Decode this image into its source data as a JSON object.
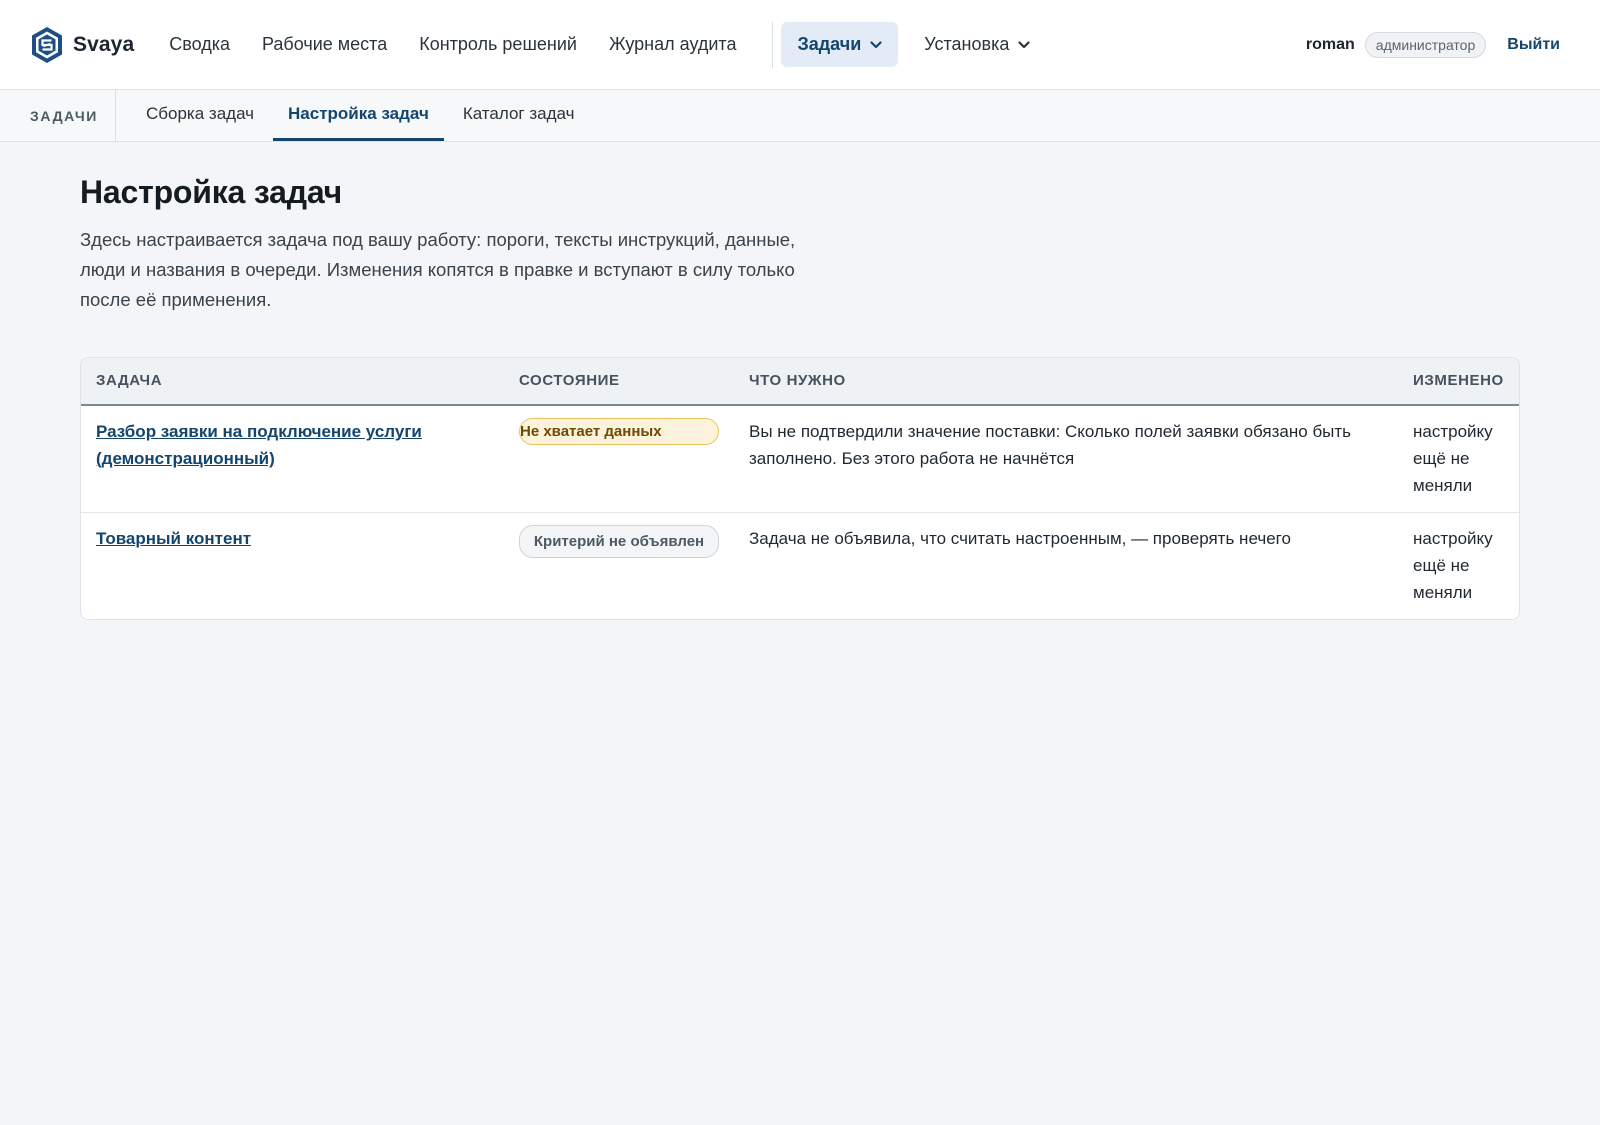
{
  "app": {
    "name": "Svaya"
  },
  "nav": {
    "items": [
      "Сводка",
      "Рабочие места",
      "Контроль решений",
      "Журнал аудита"
    ],
    "tasks": "Задачи",
    "install": "Установка"
  },
  "user": {
    "name": "roman",
    "role": "администратор",
    "logout": "Выйти"
  },
  "subnav": {
    "section": "ЗАДАЧИ",
    "tabs": [
      "Сборка задач",
      "Настройка задач",
      "Каталог задач"
    ],
    "active_tab": "Настройка задач"
  },
  "page": {
    "title": "Настройка задач",
    "description": "Здесь настраивается задача под вашу работу: пороги, тексты инструкций, данные, люди и названия в очереди. Изменения копятся в правке и вступают в силу только после её применения."
  },
  "table": {
    "headers": [
      "ЗАДАЧА",
      "СОСТОЯНИЕ",
      "ЧТО НУЖНО",
      "ИЗМЕНЕНО"
    ],
    "rows": [
      {
        "task": "Разбор заявки на подключение услуги (демонстрационный)",
        "state": "Не хватает данных",
        "need": "Вы не подтвердили значение поставки: Сколько полей заявки обязано быть заполнено. Без этого работа не начнётся",
        "changed": "настройку ещё не меняли"
      },
      {
        "task": "Товарный контент",
        "state": "Критерий не объявлен",
        "need": "Задача не объявила, что считать настроенным, — проверять нечего",
        "changed": "настройку ещё не меняли"
      }
    ]
  },
  "colors": {
    "accent": "#14456f",
    "active_nav_bg": "#e3ecf6",
    "warn_bg": "#fdf3dc",
    "warn_border": "#ecc25f",
    "warn_text": "#6e4a00",
    "neutral_badge_bg": "#f3f5f7"
  },
  "icons": {
    "logo": "svaya-hexagon-logo",
    "dropdown": "chevron-down-icon"
  }
}
